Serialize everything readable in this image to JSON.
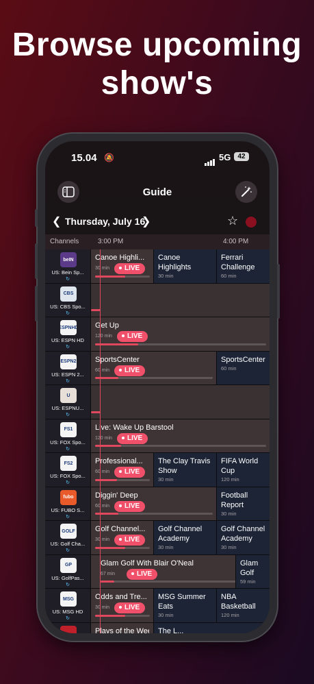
{
  "headline": [
    "Browse upcoming",
    "show's"
  ],
  "status": {
    "time": "15.04",
    "network": "5G",
    "battery": "42"
  },
  "header": {
    "title": "Guide"
  },
  "datebar": {
    "date": "Thursday, July 16",
    "prev": "❮",
    "next": "❯",
    "star": "☆"
  },
  "timeline": {
    "channels_label": "Channels",
    "slots": [
      "3:00 PM",
      "4:00 PM"
    ]
  },
  "colors": {
    "accent": "#f0506a",
    "live": "#f0506a"
  },
  "live_label": "LIVE",
  "rows": [
    {
      "channel": "US: Bein Sp...",
      "logo": "beIN",
      "logo_color": "#5b3a8a",
      "programs": [
        {
          "title": "Canoe Highli...",
          "duration": "30 min",
          "live": true,
          "progress": 0.55
        },
        {
          "title": "Canoe Highlights",
          "duration": "30 min"
        },
        {
          "title": "Ferrari Challenge",
          "duration": "60 min"
        }
      ]
    },
    {
      "channel": "US: CBS Spo...",
      "logo": "CBS",
      "logo_color": "#dfe6ee",
      "programs": []
    },
    {
      "channel": "US: ESPN HD",
      "logo": "ESPNHD",
      "logo_color": "#f4f4f4",
      "programs": [
        {
          "title": "Get Up",
          "duration": "120 min",
          "live": true,
          "progress": 0.25
        }
      ]
    },
    {
      "channel": "US: ESPN 2...",
      "logo": "ESPN2",
      "logo_color": "#f4f4f4",
      "programs": [
        {
          "title": "SportsCenter",
          "duration": "60 min",
          "live": true,
          "progress": 0.2
        },
        {
          "title": "SportsCenter",
          "duration": "60 min"
        }
      ]
    },
    {
      "channel": "US: ESPNU...",
      "logo": "U",
      "logo_color": "#e8e0d8",
      "programs": []
    },
    {
      "channel": "US: FOX Spo...",
      "logo": "FS1",
      "logo_color": "#f4f4f4",
      "programs": [
        {
          "title": "Live: Wake Up Barstool",
          "duration": "120 min",
          "live": true,
          "progress": 0.15
        }
      ]
    },
    {
      "channel": "US: FOX Spo...",
      "logo": "FS2",
      "logo_color": "#f4f4f4",
      "programs": [
        {
          "title": "Professional...",
          "duration": "60 min",
          "live": true,
          "progress": 0.4
        },
        {
          "title": "The Clay Travis Show",
          "duration": "30 min"
        },
        {
          "title": "FIFA World Cup",
          "duration": "120 min"
        }
      ]
    },
    {
      "channel": "US: FUBO S...",
      "logo": "fubo",
      "logo_color": "#e85a2a",
      "programs": [
        {
          "title": "Diggin' Deep",
          "duration": "60 min",
          "live": true,
          "progress": 0.2
        },
        {
          "title": "Football Report",
          "duration": "30 min"
        }
      ]
    },
    {
      "channel": "US: Golf Cha...",
      "logo": "GOLF",
      "logo_color": "#f4f4f4",
      "programs": [
        {
          "title": "Golf Channel...",
          "duration": "30 min",
          "live": true,
          "progress": 0.55
        },
        {
          "title": "Golf Channel Academy",
          "duration": "30 min"
        },
        {
          "title": "Golf Channel Academy",
          "duration": "30 min"
        }
      ]
    },
    {
      "channel": "US: GolfPas...",
      "logo": "GP",
      "logo_color": "#f4f4f4",
      "programs": [
        {
          "title": "Glam Golf With Blair O'Neal",
          "duration": "67 min",
          "live": true,
          "progress": 0.1
        },
        {
          "title": "Glam Golf",
          "duration": "59 min"
        }
      ]
    },
    {
      "channel": "US: MSG HD",
      "logo": "MSG",
      "logo_color": "#f4f4f4",
      "programs": [
        {
          "title": "Odds and Tre...",
          "duration": "30 min",
          "live": true,
          "progress": 0.55
        },
        {
          "title": "MSG Summer Eats",
          "duration": "30 min"
        },
        {
          "title": "NBA Basketball",
          "duration": "120 min"
        }
      ]
    },
    {
      "channel": "",
      "logo": "",
      "logo_color": "#c0202a",
      "programs": [
        {
          "title": "Plays of the Week",
          "duration": "",
          "live": false,
          "progress": 0.5
        },
        {
          "title": "The L...",
          "duration": ""
        }
      ]
    }
  ]
}
